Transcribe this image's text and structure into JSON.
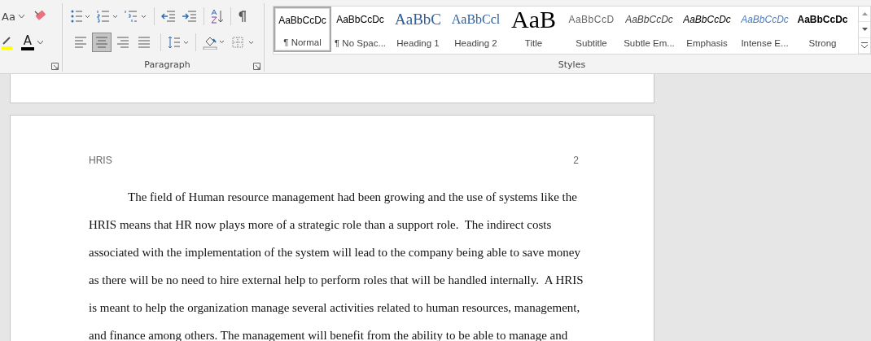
{
  "ribbon": {
    "font_group": {
      "change_case_label": "Aa",
      "font_color_label": "A"
    },
    "paragraph_group": {
      "label": "Paragraph",
      "alignments": [
        {
          "kind": "left",
          "selected": false
        },
        {
          "kind": "center",
          "selected": true
        },
        {
          "kind": "right",
          "selected": false
        },
        {
          "kind": "justify",
          "selected": false
        }
      ]
    },
    "styles_group": {
      "label": "Styles",
      "styles": [
        {
          "kind": "normal",
          "preview": "AaBbCcDc",
          "name": "¶ Normal",
          "selected": true
        },
        {
          "kind": "normal",
          "preview": "AaBbCcDc",
          "name": "¶ No Spac...",
          "selected": false
        },
        {
          "kind": "heading1",
          "preview": "AaBbC",
          "name": "Heading 1",
          "selected": false
        },
        {
          "kind": "heading2",
          "preview": "AaBbCcl",
          "name": "Heading 2",
          "selected": false
        },
        {
          "kind": "title",
          "preview": "AaB",
          "name": "Title",
          "selected": false
        },
        {
          "kind": "subtitle",
          "preview": "AaBbCcD",
          "name": "Subtitle",
          "selected": false
        },
        {
          "kind": "subtle",
          "preview": "AaBbCcDc",
          "name": "Subtle Em...",
          "selected": false
        },
        {
          "kind": "emphasis",
          "preview": "AaBbCcDc",
          "name": "Emphasis",
          "selected": false
        },
        {
          "kind": "intense",
          "preview": "AaBbCcDc",
          "name": "Intense E...",
          "selected": false
        },
        {
          "kind": "strong",
          "preview": "AaBbCcDc",
          "name": "Strong",
          "selected": false
        }
      ]
    }
  },
  "document": {
    "header_left": "HRIS",
    "page_number": "2",
    "lines": [
      "The field of Human resource management had been growing and the use of systems like the",
      "HRIS means that HR now plays more of a strategic role than a support role.  The indirect costs",
      "associated with the implementation of the system will lead to the company being able to save money",
      "as there will be no need to hire external help to perform roles that will be handled internally.  A HRIS",
      "is meant to help the organization manage several activities related to human resources, management,",
      "and finance among others. The management will benefit from the ability to be able to manage and"
    ]
  }
}
